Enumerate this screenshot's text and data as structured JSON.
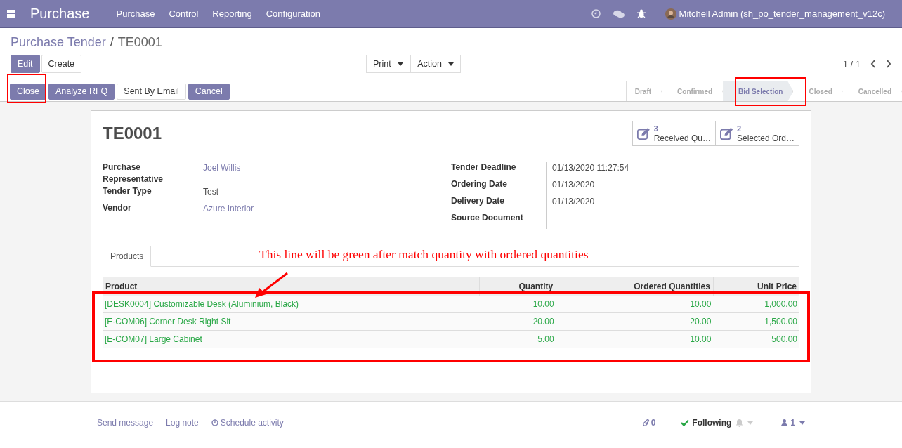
{
  "navbar": {
    "app_title": "Purchase",
    "menu": [
      "Purchase",
      "Control",
      "Reporting",
      "Configuration"
    ],
    "user": "Mitchell Admin (sh_po_tender_management_v12c)"
  },
  "breadcrumb": {
    "parent": "Purchase Tender",
    "separator": "/",
    "current": "TE0001"
  },
  "buttons": {
    "left": [
      {
        "label": "Edit",
        "primary": true
      },
      {
        "label": "Create",
        "primary": false
      }
    ],
    "center": [
      "Print",
      "Action"
    ],
    "pager": "1 / 1"
  },
  "actions": [
    {
      "label": "Close",
      "primary": true
    },
    {
      "label": "Analyze RFQ",
      "primary": true
    },
    {
      "label": "Sent By Email",
      "primary": false
    },
    {
      "label": "Cancel",
      "primary": true
    }
  ],
  "stages": [
    {
      "label": "Draft",
      "selected": false
    },
    {
      "label": "Confirmed",
      "selected": false
    },
    {
      "label": "Bid Selection",
      "selected": true
    },
    {
      "label": "Closed",
      "selected": false
    },
    {
      "label": "Cancelled",
      "selected": false
    }
  ],
  "record": {
    "title": "TE0001",
    "smart_buttons": [
      {
        "count": "3",
        "label": "Received Qu…"
      },
      {
        "count": "2",
        "label": "Selected Ord…"
      }
    ],
    "left_fields": [
      {
        "label": "Purchase Representative",
        "value": "Joel Willis",
        "link": true
      },
      {
        "label": "Tender Type",
        "value": "Test",
        "link": false
      },
      {
        "label": "Vendor",
        "value": "Azure Interior",
        "link": true
      }
    ],
    "right_fields": [
      {
        "label": "Tender Deadline",
        "value": "01/13/2020 11:27:54"
      },
      {
        "label": "Ordering Date",
        "value": "01/13/2020"
      },
      {
        "label": "Delivery Date",
        "value": "01/13/2020"
      },
      {
        "label": "Source Document"
      }
    ]
  },
  "tabs": [
    {
      "label": "Products",
      "selected": true
    }
  ],
  "table": {
    "columns": [
      "Product",
      "Quantity",
      "Ordered Quantities",
      "Unit Price"
    ],
    "rows": [
      [
        "[DESK0004] Customizable Desk (Aluminium, Black)",
        "10.00",
        "10.00",
        "1,000.00"
      ],
      [
        "[E-COM06] Corner Desk Right Sit",
        "20.00",
        "20.00",
        "1,500.00"
      ],
      [
        "[E-COM07] Large Cabinet",
        "5.00",
        "10.00",
        "500.00"
      ]
    ]
  },
  "annotation": {
    "text": "This line will be green after match quantity with ordered quantities"
  },
  "chatter": {
    "links": [
      "Send message",
      "Log note",
      "Schedule activity"
    ],
    "attachments": "0",
    "following": "Following",
    "followers": "1"
  }
}
